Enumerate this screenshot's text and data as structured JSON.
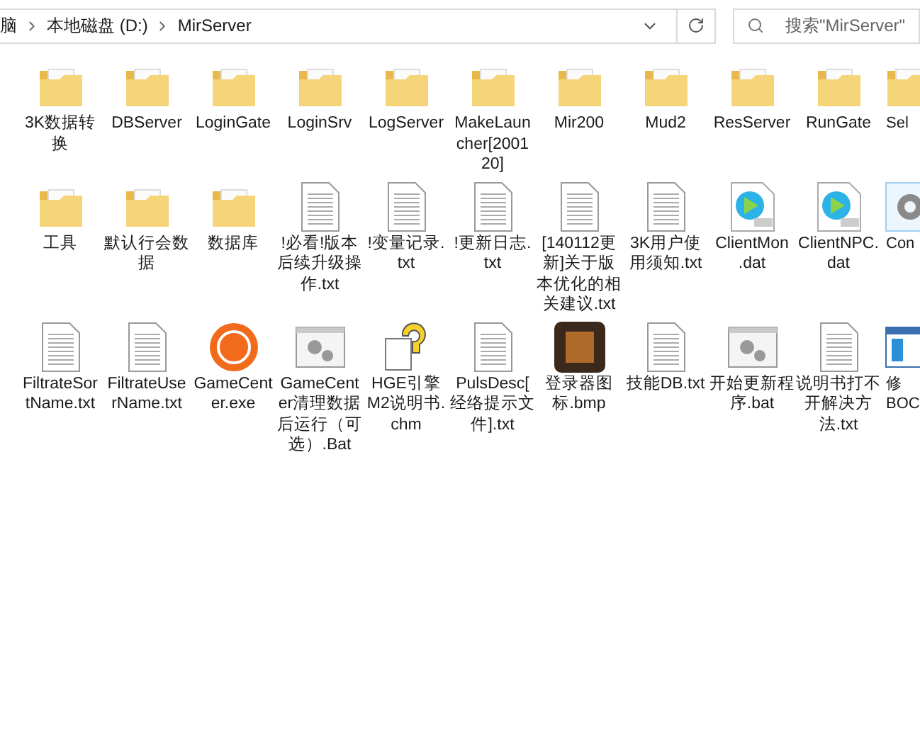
{
  "address_bar": {
    "breadcrumbs": [
      "脑",
      "本地磁盘 (D:)",
      "MirServer"
    ]
  },
  "search": {
    "placeholder": "搜索\"MirServer\""
  },
  "rows": [
    [
      {
        "kind": "folder",
        "lines": [
          "3K数据转",
          "换"
        ]
      },
      {
        "kind": "folder",
        "lines": [
          "DBServer"
        ]
      },
      {
        "kind": "folder",
        "lines": [
          "LoginGate"
        ]
      },
      {
        "kind": "folder",
        "lines": [
          "LoginSrv"
        ]
      },
      {
        "kind": "folder",
        "lines": [
          "LogServer"
        ]
      },
      {
        "kind": "folder",
        "lines": [
          "MakeLaun",
          "cher[2001",
          "20]"
        ]
      },
      {
        "kind": "folder",
        "lines": [
          "Mir200"
        ]
      },
      {
        "kind": "folder",
        "lines": [
          "Mud2"
        ]
      },
      {
        "kind": "folder",
        "lines": [
          "ResServer"
        ]
      },
      {
        "kind": "folder",
        "lines": [
          "RunGate"
        ]
      },
      {
        "kind": "folder",
        "lines": [
          "Sel"
        ]
      }
    ],
    [
      {
        "kind": "folder",
        "lines": [
          "工具"
        ]
      },
      {
        "kind": "folder",
        "lines": [
          "默认行会数",
          "据"
        ]
      },
      {
        "kind": "folder",
        "lines": [
          "数据库"
        ]
      },
      {
        "kind": "text",
        "lines": [
          "!必看!版本",
          "后续升级操",
          "作.txt"
        ]
      },
      {
        "kind": "text",
        "lines": [
          "!变量记录.",
          "txt"
        ]
      },
      {
        "kind": "text",
        "lines": [
          "!更新日志.",
          "txt"
        ]
      },
      {
        "kind": "text",
        "lines": [
          "[140112更",
          "新]关于版",
          "本优化的相",
          "关建议.txt"
        ]
      },
      {
        "kind": "text",
        "lines": [
          "3K用户使",
          "用须知.txt"
        ]
      },
      {
        "kind": "video",
        "lines": [
          "ClientMon",
          ".dat"
        ]
      },
      {
        "kind": "video",
        "lines": [
          "ClientNPC.",
          "dat"
        ]
      },
      {
        "kind": "config",
        "lines": [
          "Con"
        ]
      }
    ],
    [
      {
        "kind": "text",
        "lines": [
          "FiltrateSor",
          "tName.txt"
        ]
      },
      {
        "kind": "text",
        "lines": [
          "FiltrateUse",
          "rName.txt"
        ]
      },
      {
        "kind": "exe",
        "lines": [
          "GameCent",
          "er.exe"
        ]
      },
      {
        "kind": "bat",
        "lines": [
          "GameCent",
          "er清理数据",
          "后运行（可",
          "选）.Bat"
        ]
      },
      {
        "kind": "help",
        "lines": [
          "HGE引擎",
          "M2说明书.",
          "chm"
        ]
      },
      {
        "kind": "text",
        "lines": [
          "PulsDesc[",
          "经络提示文",
          "件].txt"
        ]
      },
      {
        "kind": "image",
        "lines": [
          "登录器图",
          "标.bmp"
        ]
      },
      {
        "kind": "text",
        "lines": [
          "技能DB.txt"
        ]
      },
      {
        "kind": "bat",
        "lines": [
          "开始更新程",
          "序.bat"
        ]
      },
      {
        "kind": "text",
        "lines": [
          "说明书打不",
          "开解决方",
          "法.txt"
        ]
      },
      {
        "kind": "app",
        "lines": [
          "修",
          "BOC"
        ]
      }
    ]
  ]
}
